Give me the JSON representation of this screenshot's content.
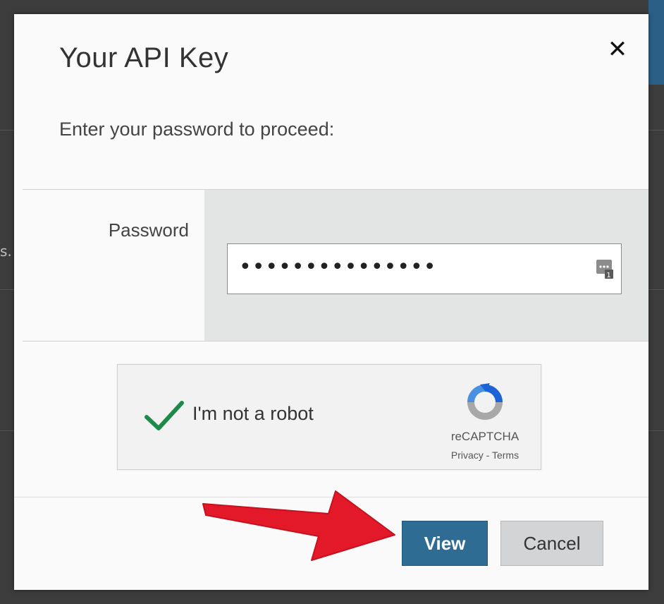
{
  "background": {
    "side_text": "s."
  },
  "modal": {
    "title": "Your API Key",
    "close_symbol": "✕",
    "instruction": "Enter your password to proceed:",
    "password_label": "Password",
    "password_value": "•••••••••••••••",
    "captcha": {
      "label": "I'm not a robot",
      "checked": true,
      "brand": "reCAPTCHA",
      "privacy": "Privacy",
      "separator": " - ",
      "terms": "Terms"
    },
    "buttons": {
      "view": "View",
      "cancel": "Cancel"
    }
  },
  "colors": {
    "primary_button": "#2e6c93",
    "secondary_button": "#d2d4d5",
    "check_green": "#1e8a4a",
    "annotation_arrow": "#e3192a"
  },
  "icons": [
    "close-icon",
    "password-manager-icon",
    "checkmark-icon",
    "recaptcha-logo-icon",
    "arrow-annotation"
  ]
}
